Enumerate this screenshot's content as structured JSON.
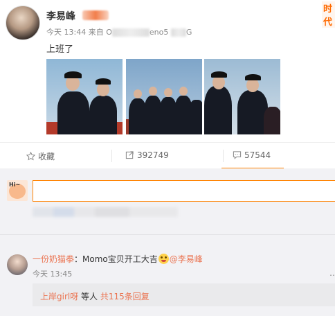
{
  "post": {
    "username": "李易峰",
    "corner_badge": "时代",
    "time": "今天 13:44",
    "source_prefix": "来自 O",
    "source_mid": "eno5",
    "source_end": "G",
    "content": "上班了"
  },
  "actions": {
    "favorite_label": "收藏",
    "repost_count": "392749",
    "comment_count": "57544"
  },
  "comment": {
    "user": "一份奶猫拳",
    "text": "：Momo宝贝开工大吉",
    "mention": "@李易峰",
    "time": "今天 13:45",
    "menu": "…",
    "reply_user": "上岸girl呀",
    "reply_mid": " 等人 ",
    "reply_link": "共115条回复"
  },
  "colors": {
    "accent": "#ff8200",
    "link": "#eb7350",
    "comment_bg": "#f2f2f5"
  }
}
